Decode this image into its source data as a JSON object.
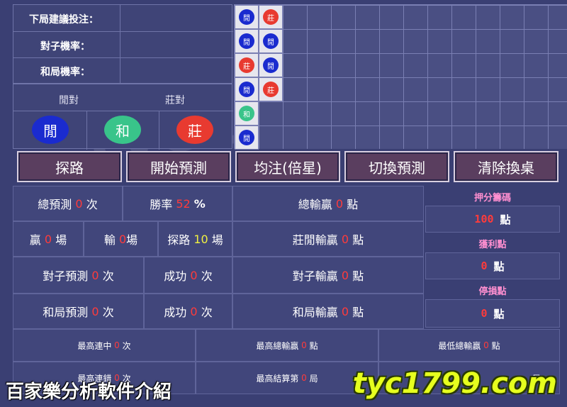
{
  "left_labels": {
    "next_suggestion": "下局建議投注：",
    "pair_rate": "對子機率：",
    "tie_rate": "和局機率："
  },
  "pairs": {
    "player_pair": "閒對",
    "banker_pair": "莊對"
  },
  "big_buttons": {
    "player": "閒",
    "tie": "和",
    "banker": "莊"
  },
  "bead_road": [
    {
      "label": "閒",
      "color": "blue"
    },
    {
      "label": "莊",
      "color": "red"
    },
    {
      "label": "閒",
      "color": "blue"
    },
    {
      "label": "閒",
      "color": "blue"
    },
    {
      "label": "莊",
      "color": "red"
    },
    {
      "label": "閒",
      "color": "blue"
    },
    {
      "label": "閒",
      "color": "blue"
    },
    {
      "label": "莊",
      "color": "red"
    },
    {
      "label": "和",
      "color": "green"
    },
    {
      "label": "閒",
      "color": "blue"
    }
  ],
  "actions": {
    "explore": "探路",
    "start_predict": "開始預測",
    "flat_bet": "均注(倍星)",
    "switch_predict": "切換預測",
    "clear_table": "清除換桌"
  },
  "stats": {
    "total_predict_prefix": "總預測",
    "total_predict_value": "0",
    "total_predict_unit": "次",
    "win_rate_prefix": "勝率",
    "win_rate_value": "52",
    "win_rate_unit": "%",
    "total_winloss_prefix": "總輸贏",
    "total_winloss_value": "0",
    "total_winloss_unit": "點",
    "win_prefix": "贏",
    "win_value": "0",
    "win_unit": "場",
    "lose_prefix": "輸",
    "lose_value": "0",
    "lose_unit": "場",
    "explore_prefix": "探路",
    "explore_value": "10",
    "explore_unit": "場",
    "bp_winloss_prefix": "莊閒輸贏",
    "bp_winloss_value": "0",
    "bp_winloss_unit": "點",
    "pair_predict_prefix": "對子預測",
    "pair_predict_value": "0",
    "pair_predict_unit": "次",
    "pair_success_prefix": "成功",
    "pair_success_value": "0",
    "pair_success_unit": "次",
    "pair_winloss_prefix": "對子輸贏",
    "pair_winloss_value": "0",
    "pair_winloss_unit": "點",
    "tie_predict_prefix": "和局預測",
    "tie_predict_value": "0",
    "tie_predict_unit": "次",
    "tie_success_prefix": "成功",
    "tie_success_value": "0",
    "tie_success_unit": "次",
    "tie_winloss_prefix": "和局輸贏",
    "tie_winloss_value": "0",
    "tie_winloss_unit": "點"
  },
  "side": {
    "bet_chip_label": "押分籌碼",
    "bet_chip_value": "100",
    "bet_chip_unit": "點",
    "profit_label": "獲利點",
    "profit_value": "0",
    "profit_unit": "點",
    "stoploss_label": "停損點",
    "stoploss_value": "0",
    "stoploss_unit": "點"
  },
  "records": {
    "max_streak_prefix": "最高連中",
    "max_streak_value": "0",
    "max_streak_unit": "次",
    "max_total_win_prefix": "最高總輸贏",
    "max_total_win_value": "0",
    "max_total_win_unit": "點",
    "min_total_win_prefix": "最低總輸贏",
    "min_total_win_value": "0",
    "min_total_win_unit": "點",
    "max_losing_prefix": "最高連錯",
    "max_losing_value": "0",
    "max_losing_unit": "次",
    "max_settle_prefix": "最高結算第",
    "max_settle_value": "0",
    "max_settle_unit": "局",
    "last_unit": "局"
  },
  "overlay": {
    "caption": "百家樂分析軟件介紹",
    "brand": "tyc1799.com",
    "watermark": "tyc1799"
  },
  "colors": {
    "background": "#3a3f73",
    "player_blue": "#1a2bcf",
    "banker_red": "#e83a30",
    "tie_green": "#39c48a",
    "button_fill": "#5a3e5f",
    "highlight_red": "#ff3b3b",
    "highlight_yellow": "#f2f240",
    "side_header_pink": "#ff8fd0",
    "brand_yellow": "#e6ff1e"
  }
}
